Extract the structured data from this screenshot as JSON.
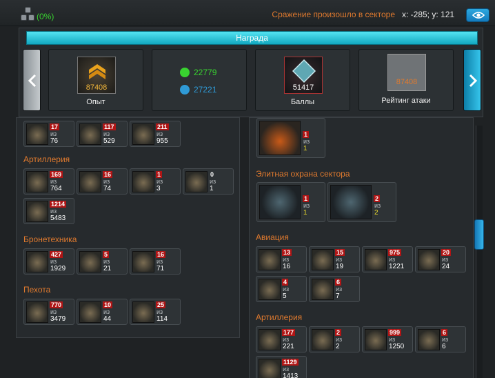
{
  "header": {
    "percent": "(0%)",
    "battle_text": "Сражение произошло в секторе",
    "coords": "x: -285; y: 121"
  },
  "reward": {
    "title": "Награда",
    "cards": [
      {
        "label": "Опыт",
        "value": "87408",
        "icon": "rank-chevron-icon"
      },
      {
        "label": "",
        "value": "",
        "icon": "resources"
      },
      {
        "label": "Баллы",
        "value": "51417",
        "icon": "crystal-icon"
      },
      {
        "label": "Рейтинг атаки",
        "value": "87408",
        "icon": "rating-icon"
      }
    ],
    "resources": [
      {
        "value": "22779",
        "icon": "radiation-icon",
        "color": "#39d430"
      },
      {
        "value": "27221",
        "icon": "credits-icon",
        "color": "#2f9ad6"
      }
    ]
  },
  "left": {
    "top_row": [
      {
        "a": "17",
        "iz": "из",
        "b": "76"
      },
      {
        "a": "117",
        "iz": "из",
        "b": "529"
      },
      {
        "a": "211",
        "iz": "из",
        "b": "955"
      }
    ],
    "sections": [
      {
        "title": "Артиллерия",
        "units": [
          {
            "a": "169",
            "iz": "из",
            "b": "764"
          },
          {
            "a": "16",
            "iz": "из",
            "b": "74"
          },
          {
            "a": "1",
            "iz": "из",
            "b": "3"
          },
          {
            "a": "0",
            "iz": "из",
            "b": "1"
          },
          {
            "a": "1214",
            "iz": "из",
            "b": "5483"
          }
        ]
      },
      {
        "title": "Бронетехника",
        "units": [
          {
            "a": "427",
            "iz": "из",
            "b": "1929"
          },
          {
            "a": "5",
            "iz": "из",
            "b": "21"
          },
          {
            "a": "16",
            "iz": "из",
            "b": "71"
          }
        ]
      },
      {
        "title": "Пехота",
        "units": [
          {
            "a": "770",
            "iz": "из",
            "b": "3479"
          },
          {
            "a": "10",
            "iz": "из",
            "b": "44"
          },
          {
            "a": "25",
            "iz": "из",
            "b": "114"
          }
        ]
      }
    ]
  },
  "right": {
    "top_unit": {
      "a": "1",
      "iz": "из",
      "b": "1"
    },
    "sections": [
      {
        "title": "Элитная охрана сектора",
        "units": [
          {
            "a": "1",
            "iz": "из",
            "b": "1"
          },
          {
            "a": "2",
            "iz": "из",
            "b": "2"
          }
        ]
      },
      {
        "title": "Авиация",
        "units": [
          {
            "a": "13",
            "iz": "из",
            "b": "16"
          },
          {
            "a": "15",
            "iz": "из",
            "b": "19"
          },
          {
            "a": "975",
            "iz": "из",
            "b": "1221"
          },
          {
            "a": "20",
            "iz": "из",
            "b": "24"
          },
          {
            "a": "4",
            "iz": "из",
            "b": "5"
          },
          {
            "a": "6",
            "iz": "из",
            "b": "7"
          }
        ]
      },
      {
        "title": "Артиллерия",
        "units": [
          {
            "a": "177",
            "iz": "из",
            "b": "221"
          },
          {
            "a": "2",
            "iz": "из",
            "b": "2"
          },
          {
            "a": "999",
            "iz": "из",
            "b": "1250"
          },
          {
            "a": "6",
            "iz": "из",
            "b": "6"
          },
          {
            "a": "1129",
            "iz": "из",
            "b": "1413"
          }
        ]
      }
    ]
  }
}
